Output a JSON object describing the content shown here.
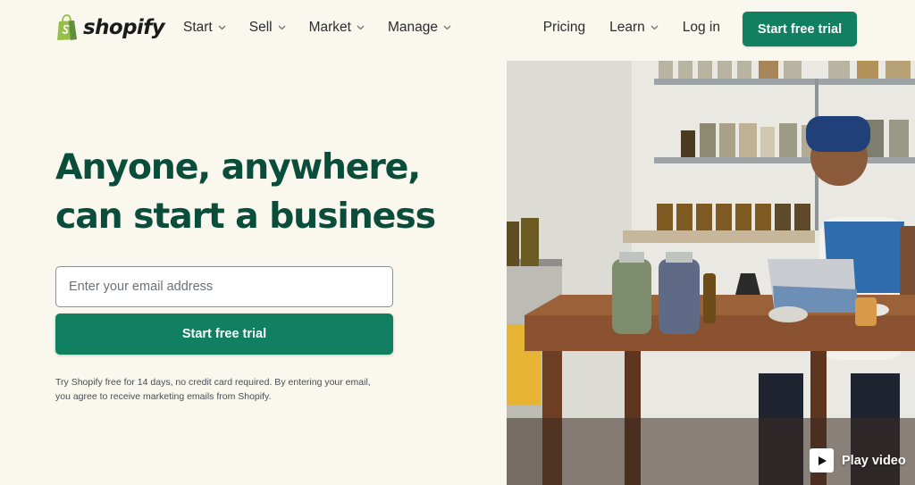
{
  "brand": {
    "name": "shopify",
    "icon": "shopify-bag-icon",
    "accent_color": "#118060",
    "headline_color": "#0a4d3a",
    "background_color": "#f9f7ee"
  },
  "nav": {
    "menus": [
      {
        "label": "Start",
        "icon": "chevron-down-icon"
      },
      {
        "label": "Sell",
        "icon": "chevron-down-icon"
      },
      {
        "label": "Market",
        "icon": "chevron-down-icon"
      },
      {
        "label": "Manage",
        "icon": "chevron-down-icon"
      }
    ],
    "pricing": "Pricing",
    "learn": "Learn",
    "learn_icon": "chevron-down-icon",
    "login": "Log in",
    "cta": "Start free trial"
  },
  "hero": {
    "headline_line1": "Anyone, anywhere,",
    "headline_line2": "can start a business",
    "email_placeholder": "Enter your email address",
    "email_value": "",
    "cta": "Start free trial",
    "disclaimer_line1": "Try Shopify free for 14 days, no credit card required. By entering your email,",
    "disclaimer_line2": "you agree to receive marketing emails from Shopify."
  },
  "media": {
    "image_subject": "woman working at a wooden table with jars and a tablet in a shop",
    "play_icon": "play-icon",
    "play_label": "Play video"
  }
}
